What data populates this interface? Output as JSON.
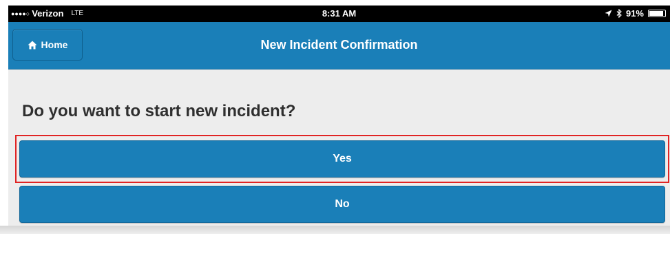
{
  "status_bar": {
    "signal": "●●●●○",
    "carrier": "Verizon",
    "network": "LTE",
    "time": "8:31 AM",
    "battery_percent": "91%",
    "battery_level": 0.91,
    "icons": [
      "location-icon",
      "bluetooth-icon",
      "battery-icon"
    ]
  },
  "nav": {
    "home_label": "Home",
    "home_icon": "home-icon",
    "title": "New Incident Confirmation"
  },
  "content": {
    "question": "Do you want to start new incident?",
    "yes_label": "Yes",
    "no_label": "No"
  },
  "colors": {
    "accent": "#1a7fb8",
    "highlight": "#e02424",
    "background": "#ededed"
  }
}
